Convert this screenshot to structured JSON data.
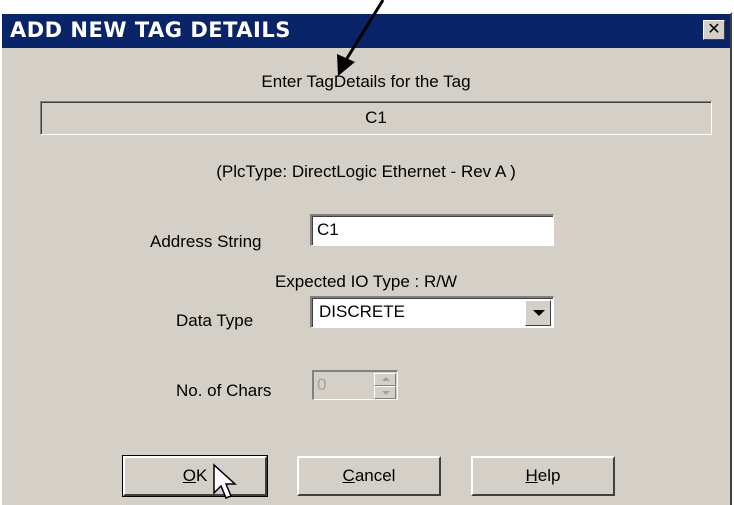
{
  "dialog": {
    "title": "ADD NEW TAG DETAILS",
    "close_label": "✕",
    "prompt": "Enter TagDetails for the Tag",
    "tag_name": "C1",
    "plc_type": "(PlcType:  DirectLogic Ethernet  - Rev A )",
    "address_label": "Address String",
    "address_value": "C1",
    "expected_io": "Expected IO Type : R/W",
    "data_type_label": "Data Type",
    "data_type_value": "DISCRETE",
    "chars_label": "No. of Chars",
    "chars_value": "0"
  },
  "buttons": {
    "ok_first": "O",
    "ok_rest": "K",
    "cancel_first": "C",
    "cancel_rest": "ancel",
    "help_first": "H",
    "help_rest": "elp"
  }
}
